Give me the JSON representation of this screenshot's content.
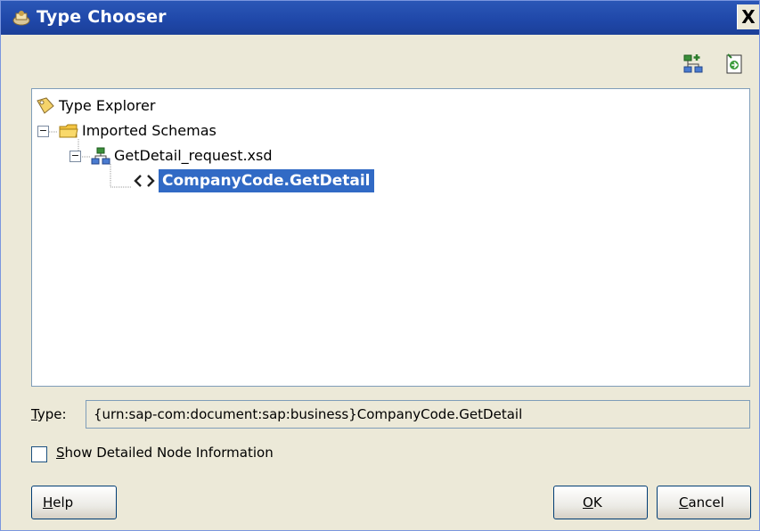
{
  "window": {
    "title": "Type Chooser",
    "close_glyph": "X"
  },
  "toolbar": {
    "icons": [
      "schema-add-icon",
      "import-icon"
    ]
  },
  "tree": {
    "root": {
      "label": "Type Explorer",
      "icon": "type-explorer-icon"
    },
    "folder": {
      "label": "Imported Schemas",
      "icon": "folder-icon",
      "expander": "−"
    },
    "schema": {
      "label": "GetDetail_request.xsd",
      "icon": "schema-icon",
      "expander": "−"
    },
    "element": {
      "label": "CompanyCode.GetDetail",
      "icon": "element-icon",
      "selected": true
    }
  },
  "type_field": {
    "label_first": "T",
    "label_rest": "ype:",
    "value": "{urn:sap-com:document:sap:business}CompanyCode.GetDetail"
  },
  "checkbox": {
    "label_first": "S",
    "label_rest": "how Detailed Node Information",
    "checked": false
  },
  "buttons": {
    "help_first": "H",
    "help_rest": "elp",
    "ok_first": "O",
    "ok_rest": "K",
    "cancel_first": "C",
    "cancel_rest": "ancel"
  },
  "colors": {
    "title_bar": "#1f47a8",
    "selection": "#316ac5",
    "dialog_bg": "#ece9d8"
  }
}
